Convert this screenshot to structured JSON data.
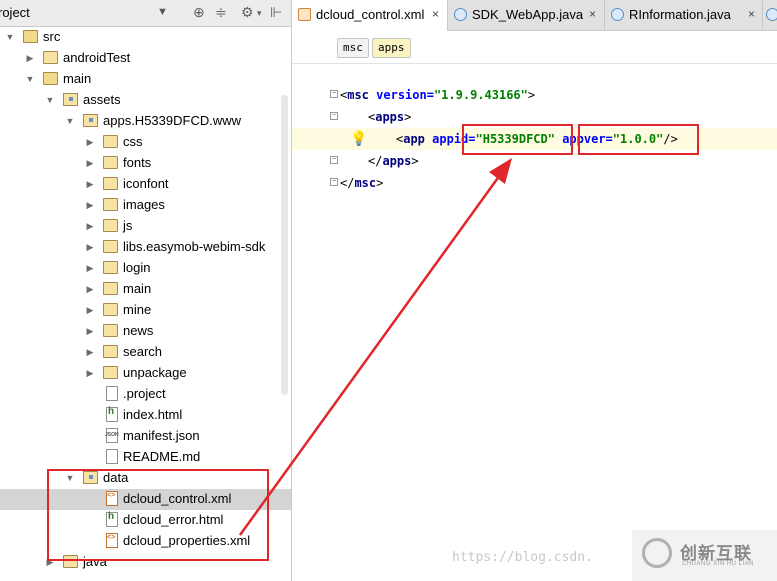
{
  "project_pane": {
    "title": "roject",
    "dropdown_icon": "triangle-down",
    "tools": [
      "target-icon",
      "collapse-icon",
      "gear-icon",
      "hide-icon"
    ],
    "tree": [
      {
        "label": "src",
        "icon": "folder",
        "expanded": true
      },
      {
        "label": "androidTest",
        "icon": "folder",
        "expanded": false
      },
      {
        "label": "main",
        "icon": "folder",
        "expanded": true
      },
      {
        "label": "assets",
        "icon": "package-folder",
        "expanded": true
      },
      {
        "label": "apps.H5339DFCD.www",
        "icon": "package-folder",
        "expanded": true
      },
      {
        "label": "css",
        "icon": "folder",
        "expanded": false
      },
      {
        "label": "fonts",
        "icon": "folder",
        "expanded": false
      },
      {
        "label": "iconfont",
        "icon": "folder",
        "expanded": false
      },
      {
        "label": "images",
        "icon": "folder",
        "expanded": false
      },
      {
        "label": "js",
        "icon": "folder",
        "expanded": false
      },
      {
        "label": "libs.easymob-webim-sdk",
        "icon": "folder",
        "expanded": false
      },
      {
        "label": "login",
        "icon": "folder",
        "expanded": false
      },
      {
        "label": "main",
        "icon": "folder",
        "expanded": false
      },
      {
        "label": "mine",
        "icon": "folder",
        "expanded": false
      },
      {
        "label": "news",
        "icon": "folder",
        "expanded": false
      },
      {
        "label": "search",
        "icon": "folder",
        "expanded": false
      },
      {
        "label": "unpackage",
        "icon": "folder",
        "expanded": false
      },
      {
        "label": ".project",
        "icon": "file"
      },
      {
        "label": "index.html",
        "icon": "html-file"
      },
      {
        "label": "manifest.json",
        "icon": "json-file"
      },
      {
        "label": "README.md",
        "icon": "file"
      },
      {
        "label": "data",
        "icon": "package-folder",
        "expanded": true
      },
      {
        "label": "dcloud_control.xml",
        "icon": "xml-file",
        "selected": true
      },
      {
        "label": "dcloud_error.html",
        "icon": "html-file"
      },
      {
        "label": "dcloud_properties.xml",
        "icon": "xml-file"
      },
      {
        "label": "java",
        "icon": "folder",
        "expanded": false
      }
    ]
  },
  "editor": {
    "tabs": [
      {
        "label": "dcloud_control.xml",
        "icon": "xml-file",
        "active": true,
        "close": "×"
      },
      {
        "label": "SDK_WebApp.java",
        "icon": "java-class",
        "active": false,
        "close": "×"
      },
      {
        "label": "RInformation.java",
        "icon": "java-class",
        "active": false,
        "close": "×"
      },
      {
        "label": "",
        "icon": "java-class",
        "active": false,
        "close": ""
      }
    ],
    "breadcrumbs": [
      "msc",
      "apps"
    ],
    "code": {
      "l1_open": "<",
      "l1_tag": "msc",
      "l1_attr": " version=",
      "l1_val": "\"1.9.9.43166\"",
      "l1_close": ">",
      "l2_open": "<",
      "l2_tag": "apps",
      "l2_close": ">",
      "l3_open": "<",
      "l3_tag": "app",
      "l3_attr1": " appid=",
      "l3_val1": "\"H5339DFCD\"",
      "l3_attr2": " appver=",
      "l3_val2": "\"1.0.0\"",
      "l3_close": "/>",
      "l4_open": "</",
      "l4_tag": "apps",
      "l4_close": ">",
      "l5_open": "</",
      "l5_tag": "msc",
      "l5_close": ">"
    },
    "intention_icon": "lightbulb-icon",
    "highlight_color": "#e0262a"
  },
  "watermark": {
    "url": "https://blog.csdn.",
    "logo_cn": "创新互联",
    "logo_sub": "CHUANG XIN HU LIAN"
  }
}
